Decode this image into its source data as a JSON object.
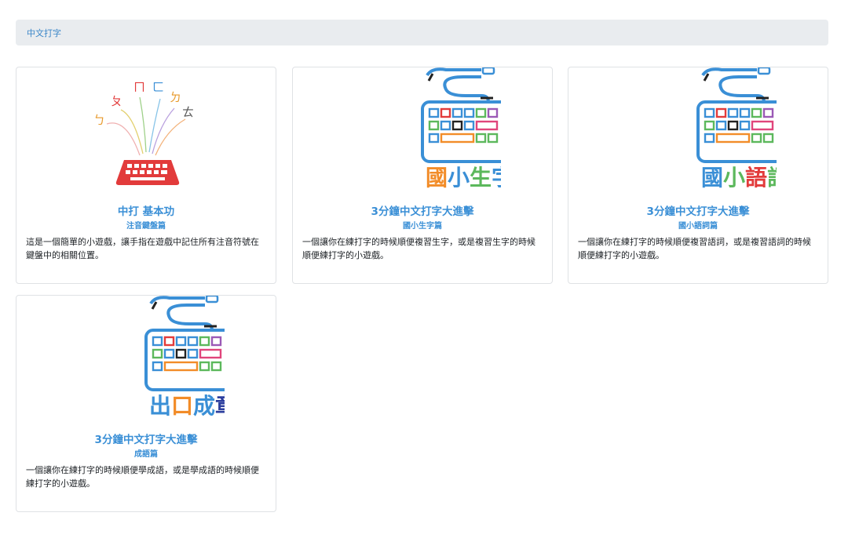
{
  "breadcrumb": {
    "item": "中文打字"
  },
  "cards": [
    {
      "image": "zhuyin-keyboard-illustration",
      "image_text": "ㄅ ㄆ ㄇ ㄈ ㄉ ㄊ",
      "title": "中打 基本功",
      "subtitle": "注音鍵盤篇",
      "description": "這是一個簡單的小遊戲，讓手指在遊戲中記住所有注音符號在鍵盤中的相關位置。"
    },
    {
      "image": "keyboard-logo",
      "image_text": "國小生字",
      "title": "3分鐘中文打字大進擊",
      "subtitle": "國小生字篇",
      "description": "一個讓你在練打字的時候順便複習生字，或是複習生字的時候順便練打字的小遊戲。"
    },
    {
      "image": "keyboard-logo",
      "image_text": "國小語詞",
      "title": "3分鐘中文打字大進擊",
      "subtitle": "國小語詞篇",
      "description": "一個讓你在練打字的時候順便複習語詞，或是複習語詞的時候順便練打字的小遊戲。"
    },
    {
      "image": "keyboard-logo",
      "image_text": "出口成章",
      "title": "3分鐘中文打字大進擊",
      "subtitle": "成語篇",
      "description": "一個讓你在練打字的時候順便學成語，或是學成語的時候順便練打字的小遊戲。"
    }
  ]
}
